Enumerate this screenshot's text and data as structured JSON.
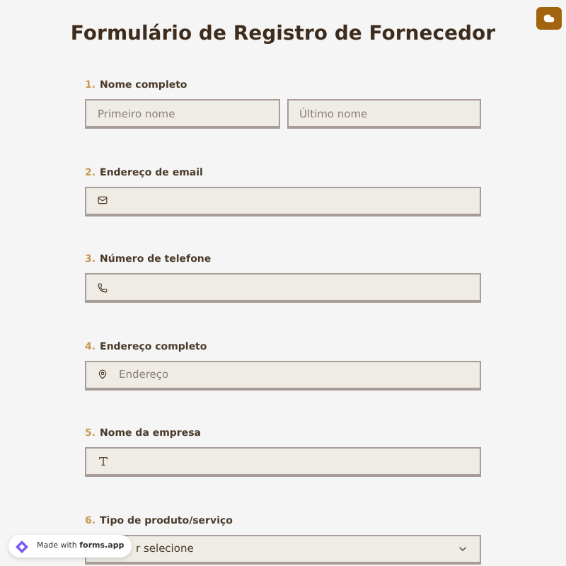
{
  "title": "Formulário de Registro de Fornecedor",
  "questions": [
    {
      "number": "1.",
      "label": "Nome completo",
      "kind": "name",
      "placeholders": [
        "Primeiro nome",
        "Último nome"
      ]
    },
    {
      "number": "2.",
      "label": "Endereço de email",
      "kind": "email"
    },
    {
      "number": "3.",
      "label": "Número de telefone",
      "kind": "phone"
    },
    {
      "number": "4.",
      "label": "Endereço completo",
      "kind": "address",
      "placeholder": "Endereço"
    },
    {
      "number": "5.",
      "label": "Nome da empresa",
      "kind": "text"
    },
    {
      "number": "6.",
      "label": "Tipo de produto/serviço",
      "kind": "select",
      "placeholder": "r selecione"
    }
  ],
  "badge": {
    "text": "Made with **forms.app**"
  }
}
